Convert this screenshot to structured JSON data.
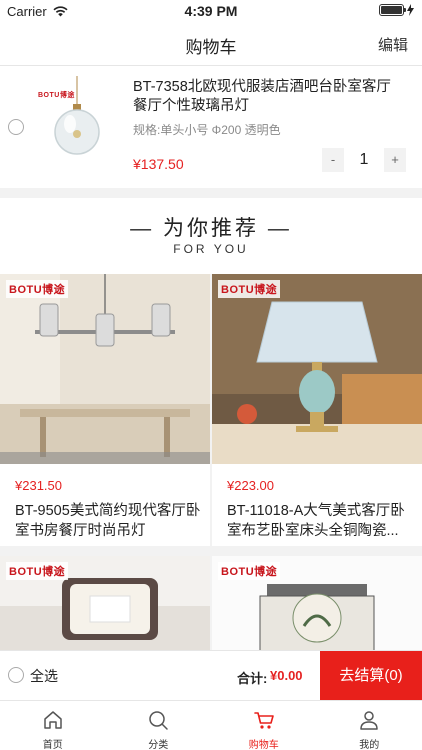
{
  "status_bar": {
    "carrier": "Carrier",
    "time": "4:39 PM"
  },
  "navbar": {
    "title": "购物车",
    "edit_label": "编辑"
  },
  "cart_item": {
    "brand": "BOTU博途",
    "name": "BT-7358北欧现代服装店酒吧台卧室客厅餐厅个性玻璃吊灯",
    "spec": "规格:单头小号 Φ200 透明色",
    "price": "¥137.50",
    "quantity": "1",
    "minus": "-",
    "plus": "+"
  },
  "recommend": {
    "title": "— 为你推荐 —",
    "subtitle": "FOR YOU"
  },
  "products": [
    {
      "brand": "BOTU博途",
      "price": "¥231.50",
      "name": "BT-9505美式简约现代客厅卧室书房餐厅时尚吊灯"
    },
    {
      "brand": "BOTU博途",
      "price": "¥223.00",
      "name": "BT-11018-A大气美式客厅卧室布艺卧室床头全铜陶瓷..."
    },
    {
      "brand": "BOTU博途",
      "price": "",
      "name": ""
    },
    {
      "brand": "BOTU博途",
      "price": "",
      "name": ""
    }
  ],
  "action_bar": {
    "select_all": "全选",
    "total_label": "合计:",
    "total_value": "¥0.00",
    "checkout": "去结算(0)"
  },
  "tabbar": [
    {
      "label": "首页",
      "icon": "home-icon"
    },
    {
      "label": "分类",
      "icon": "search-icon"
    },
    {
      "label": "购物车",
      "icon": "cart-icon",
      "active": true
    },
    {
      "label": "我的",
      "icon": "profile-icon"
    }
  ],
  "colors": {
    "accent": "#e8201b",
    "price": "#e52222",
    "brand": "#c8161d"
  }
}
